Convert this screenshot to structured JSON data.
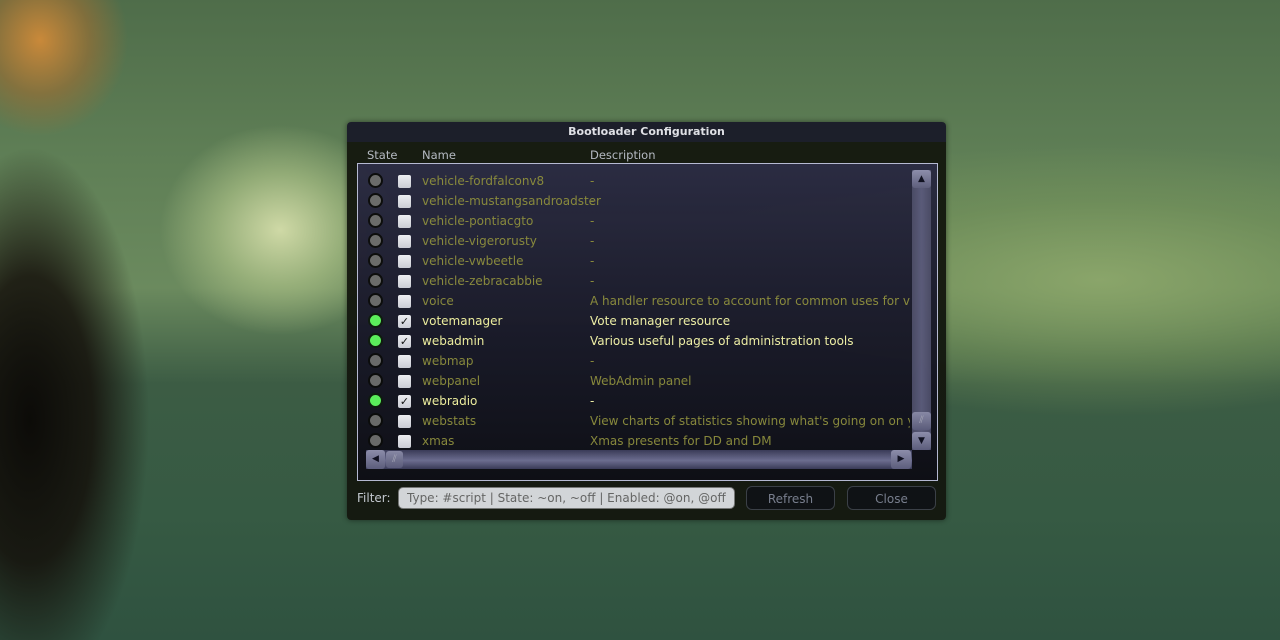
{
  "window": {
    "title": "Bootloader Configuration"
  },
  "columns": {
    "state": "State",
    "name": "Name",
    "description": "Description"
  },
  "resources": [
    {
      "name": "vehicle-fordfalconv8",
      "description": "-",
      "running": false,
      "enabled": false
    },
    {
      "name": "vehicle-mustangsandroadster",
      "description": "-",
      "running": false,
      "enabled": false
    },
    {
      "name": "vehicle-pontiacgto",
      "description": "-",
      "running": false,
      "enabled": false
    },
    {
      "name": "vehicle-vigerorusty",
      "description": "-",
      "running": false,
      "enabled": false
    },
    {
      "name": "vehicle-vwbeetle",
      "description": "-",
      "running": false,
      "enabled": false
    },
    {
      "name": "vehicle-zebracabbie",
      "description": "-",
      "running": false,
      "enabled": false
    },
    {
      "name": "voice",
      "description": "A handler resource to account for common uses for voice su",
      "running": false,
      "enabled": false
    },
    {
      "name": "votemanager",
      "description": "Vote manager resource",
      "running": true,
      "enabled": true
    },
    {
      "name": "webadmin",
      "description": "Various useful pages of administration tools",
      "running": true,
      "enabled": true
    },
    {
      "name": "webmap",
      "description": "-",
      "running": false,
      "enabled": false
    },
    {
      "name": "webpanel",
      "description": "WebAdmin panel",
      "running": false,
      "enabled": false
    },
    {
      "name": "webradio",
      "description": "-",
      "running": true,
      "enabled": true
    },
    {
      "name": "webstats",
      "description": "View charts of statistics showing what's going on on your se",
      "running": false,
      "enabled": false
    },
    {
      "name": "xmas",
      "description": "Xmas presents for DD and DM",
      "running": false,
      "enabled": false
    }
  ],
  "icons": {
    "scroll_up": "▲",
    "scroll_down": "▼",
    "scroll_left": "◀",
    "scroll_right": "▶",
    "grip": "⫽",
    "check": "✓"
  },
  "footer": {
    "filter_label": "Filter:",
    "filter_value": "",
    "filter_placeholder": "Type: #script | State: ~on, ~off | Enabled: @on, @off",
    "refresh_label": "Refresh",
    "close_label": "Close"
  },
  "colors": {
    "state_on": "#5cf25c",
    "state_off": "#6b6b6b",
    "text_on": "#f1f1a0",
    "text_off": "#8a8a3c"
  }
}
